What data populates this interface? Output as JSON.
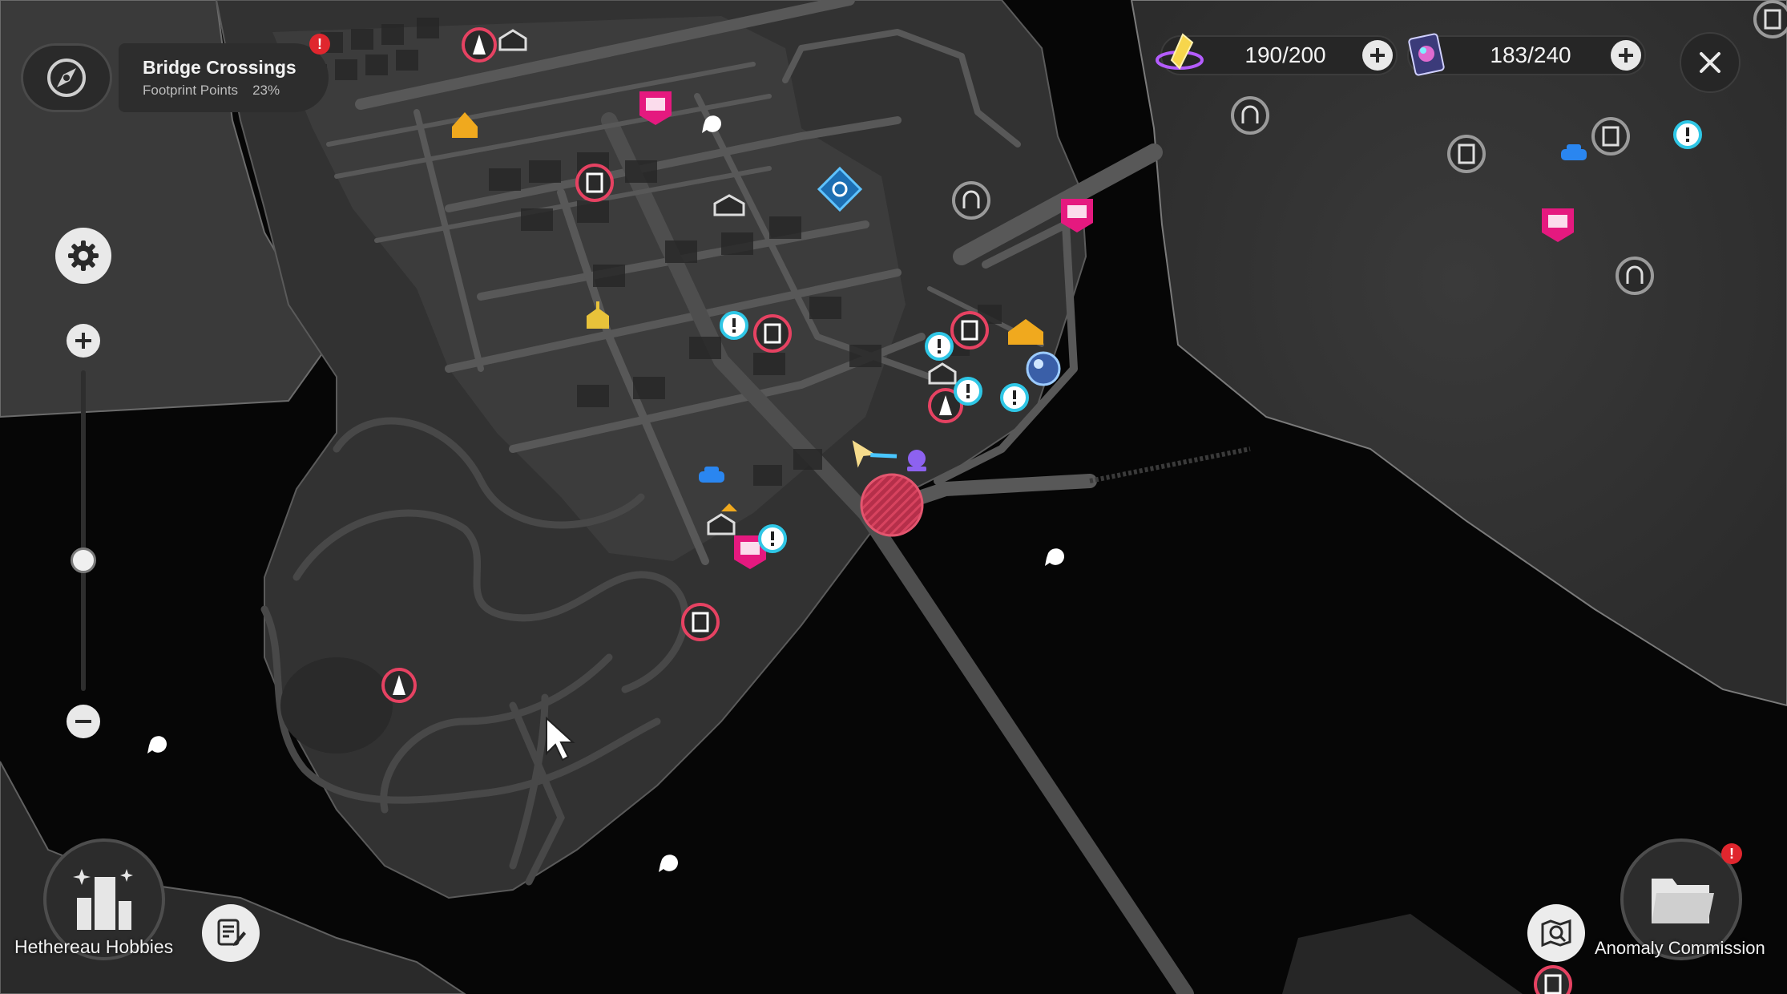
{
  "region": {
    "name": "Bridge Crossings",
    "points_label": "Footprint Points",
    "points_value": "23%",
    "alert": "!"
  },
  "resources": [
    {
      "icon": "energy-crystal-icon",
      "value": "190/200"
    },
    {
      "icon": "card-pack-icon",
      "value": "183/240"
    }
  ],
  "bottom": {
    "left_button_label": "Hethereau Hobbies",
    "right_button_label": "Anomaly Commission",
    "right_alert": "!"
  },
  "colors": {
    "accent_red": "#e0262e",
    "marker_pink": "#e5197f",
    "marker_cyan": "#2fc7e6",
    "marker_gold": "#f0a91e",
    "land": "#303030",
    "water": "#060606"
  },
  "map_markers": [
    "tower-marker-icon",
    "shop-marker-icon",
    "home-marker-icon",
    "race-flag-marker-icon",
    "locker-marker-icon",
    "warehouse-marker-icon",
    "fast-travel-marker-icon",
    "gate-marker-icon",
    "quest-marker-icon",
    "car-marker-icon",
    "fish-spot-marker-icon",
    "player-marker-icon",
    "target-zone-marker"
  ]
}
